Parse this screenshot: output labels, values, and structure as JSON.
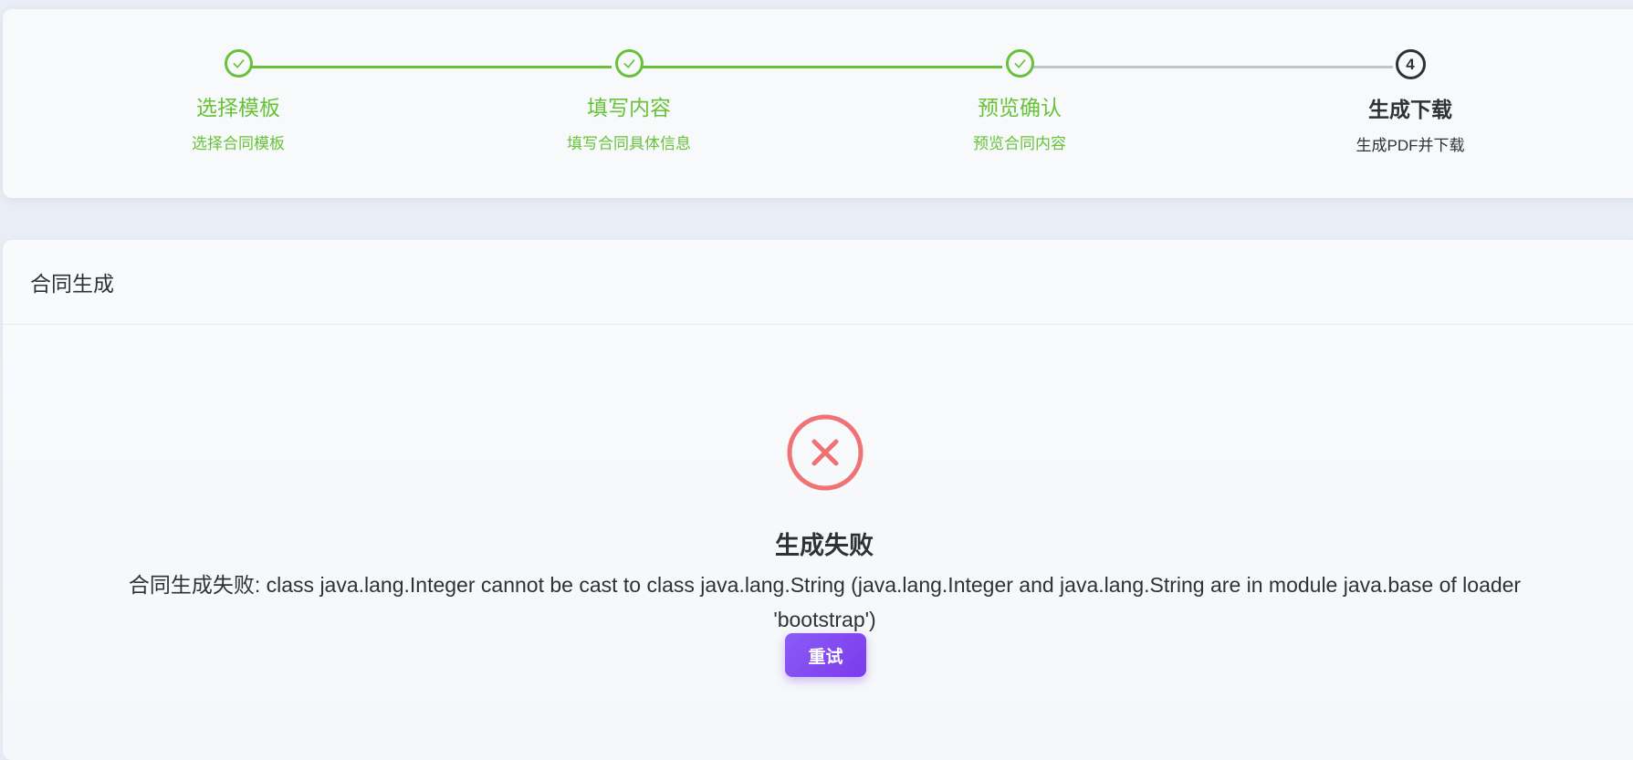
{
  "steps": [
    {
      "title": "选择模板",
      "desc": "选择合同模板",
      "status": "done"
    },
    {
      "title": "填写内容",
      "desc": "填写合同具体信息",
      "status": "done"
    },
    {
      "title": "预览确认",
      "desc": "预览合同内容",
      "status": "done"
    },
    {
      "title": "生成下载",
      "desc": "生成PDF并下载",
      "status": "current",
      "number": "4"
    }
  ],
  "card": {
    "header": "合同生成"
  },
  "result": {
    "status": "error",
    "title": "生成失败",
    "subtitle": "合同生成失败: class java.lang.Integer cannot be cast to class java.lang.String (java.lang.Integer and java.lang.String are in module java.base of loader 'bootstrap')",
    "retry_label": "重试"
  },
  "colors": {
    "success": "#67c23a",
    "pending_line": "#c0c4cc",
    "error": "#f07275",
    "primary": "#7c3aed",
    "text": "#303133"
  },
  "icons": {
    "step_done": "check-icon",
    "result": "error-circle-icon"
  }
}
